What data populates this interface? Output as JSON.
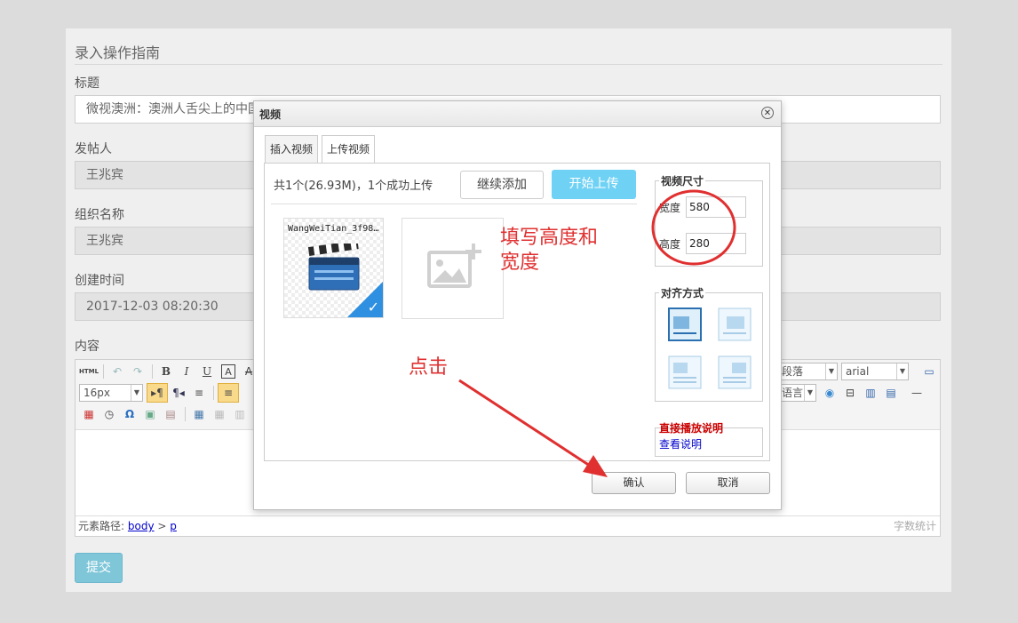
{
  "page": {
    "title": "录入操作指南",
    "fields": {
      "title_label": "标题",
      "title_value": "微视澳洲：澳洲人舌尖上的中国",
      "poster_label": "发帖人",
      "poster_value": "王兆宾",
      "org_label": "组织名称",
      "org_value": "王兆宾",
      "created_label": "创建时间",
      "created_value": "2017-12-03 08:20:30",
      "content_label": "内容"
    },
    "editor": {
      "font_size": "16px",
      "paragraph": "段落",
      "font_family": "arial",
      "language": "语言",
      "status_path_label": "元素路径:",
      "status_body": "body",
      "status_sep": ">",
      "status_p": "p",
      "word_count": "字数统计"
    },
    "submit_label": "提交"
  },
  "dialog": {
    "title": "视频",
    "close_icon": "close-icon",
    "tabs": [
      {
        "label": "插入视频"
      },
      {
        "label": "上传视频"
      }
    ],
    "upload_info": "共1个(26.93M)，1个成功上传",
    "continue_add": "继续添加",
    "start_upload": "开始上传",
    "file_name": "WangWeiTian_3f98…",
    "video_size": {
      "legend": "视频尺寸",
      "width_label": "宽度",
      "width_value": "580",
      "height_label": "高度",
      "height_value": "280"
    },
    "align": {
      "legend": "对齐方式"
    },
    "direct_play": "直接播放说明",
    "view_explain": "查看说明",
    "ok_label": "确认",
    "cancel_label": "取消"
  },
  "annotations": {
    "fill_hint_line1": "填写高度和",
    "fill_hint_line2": "宽度",
    "click_hint": "点击",
    "color": "#e03030"
  }
}
